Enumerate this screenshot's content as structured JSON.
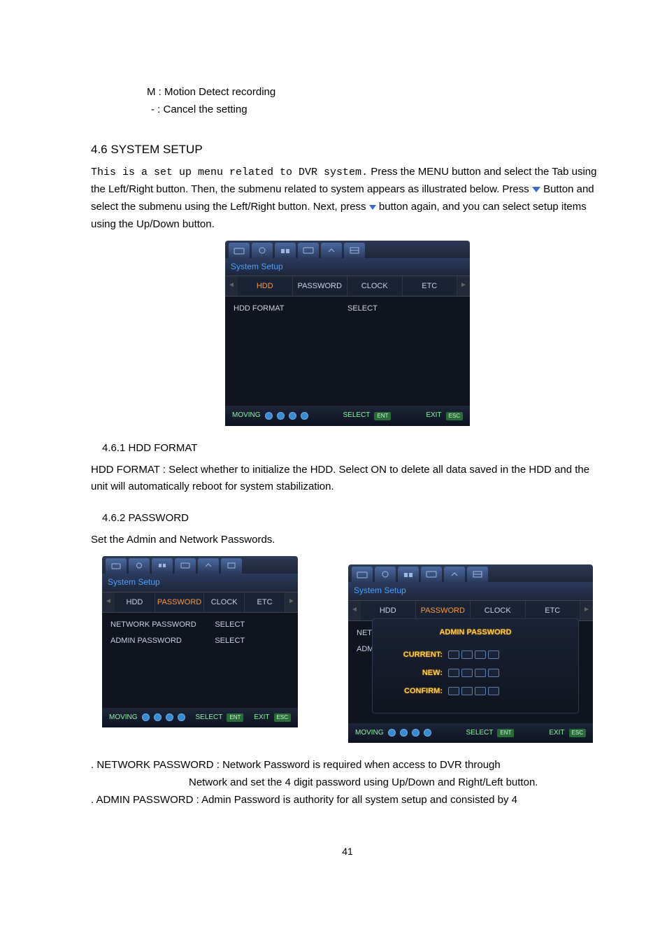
{
  "bullets": {
    "m": "M : Motion Detect recording",
    "dash": "- : Cancel the setting"
  },
  "heading_4_6": "4.6 SYSTEM SETUP",
  "para1a": "This is a set up menu related to DVR system.",
  "para1b": " Press the MENU button and select the Tab using the Left/Right button. Then, the submenu related to system appears as illustrated below. Press ",
  "para1c": " Button and select the submenu using the Left/Right button. Next, press ",
  "para1d": " button again, and you can select setup items using the Up/Down button.",
  "dvr1": {
    "title": "System Setup",
    "tabs": {
      "hdd": "HDD",
      "password": "PASSWORD",
      "clock": "CLOCK",
      "etc": "ETC"
    },
    "row": {
      "label": "HDD FORMAT",
      "value": "SELECT"
    }
  },
  "footer_labels": {
    "moving": "MOVING",
    "select": "SELECT",
    "exit": "EXIT",
    "ent": "ENT",
    "esc": "ESC"
  },
  "heading_4_6_1": "4.6.1 HDD FORMAT",
  "hdd_format_text": "HDD FORMAT : Select whether to initialize the HDD. Select ON to delete all data saved in the HDD and the unit will automatically reboot for system stabilization.",
  "heading_4_6_2": "4.6.2 PASSWORD",
  "set_pw_text": "Set the Admin and Network Passwords.",
  "dvr2": {
    "title": "System Setup",
    "tabs": {
      "hdd": "HDD",
      "password": "PASSWORD",
      "clock": "CLOCK",
      "etc": "ETC"
    },
    "rows": {
      "net": {
        "label": "NETWORK PASSWORD",
        "value": "SELECT"
      },
      "adm": {
        "label": "ADMIN PASSWORD",
        "value": "SELECT"
      }
    }
  },
  "dvr3": {
    "title": "System Setup",
    "tabs": {
      "hdd": "HDD",
      "password": "PASSWORD",
      "clock": "CLOCK",
      "etc": "ETC"
    },
    "body": {
      "net_short": "NET",
      "adm_short": "ADM"
    },
    "popup": {
      "title": "ADMIN PASSWORD",
      "current": "CURRENT:",
      "new": "NEW:",
      "confirm": "CONFIRM:"
    }
  },
  "netpw_line1": ". NETWORK PASSWORD : Network Password is required when access to DVR through",
  "netpw_line2": "Network and set the 4 digit password using Up/Down and Right/Left button.",
  "admpw_line": ". ADMIN PASSWORD : Admin Password is authority for all system setup and consisted by 4",
  "pagenum": "41"
}
